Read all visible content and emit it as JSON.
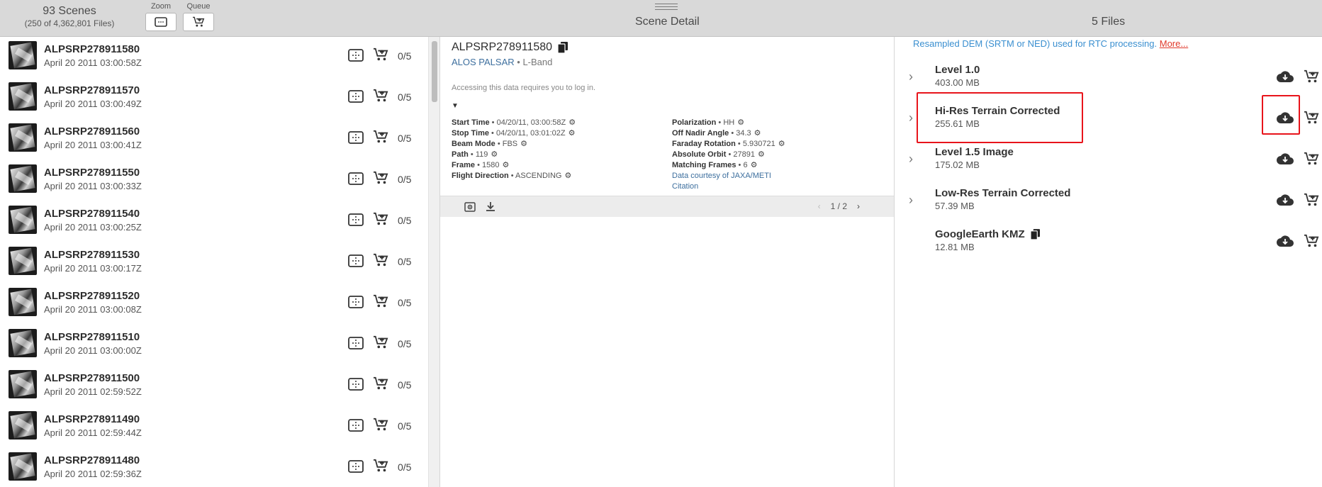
{
  "toolbar": {
    "scene_count": "93 Scenes",
    "files_count": "(250 of 4,362,801 Files)",
    "zoom_label": "Zoom",
    "queue_label": "Queue",
    "detail_title": "Scene Detail",
    "files_title": "5 Files"
  },
  "scenes": [
    {
      "name": "ALPSRP278911580",
      "date": "April 20 2011 03:00:58Z",
      "count": "0/5"
    },
    {
      "name": "ALPSRP278911570",
      "date": "April 20 2011 03:00:49Z",
      "count": "0/5"
    },
    {
      "name": "ALPSRP278911560",
      "date": "April 20 2011 03:00:41Z",
      "count": "0/5"
    },
    {
      "name": "ALPSRP278911550",
      "date": "April 20 2011 03:00:33Z",
      "count": "0/5"
    },
    {
      "name": "ALPSRP278911540",
      "date": "April 20 2011 03:00:25Z",
      "count": "0/5"
    },
    {
      "name": "ALPSRP278911530",
      "date": "April 20 2011 03:00:17Z",
      "count": "0/5"
    },
    {
      "name": "ALPSRP278911520",
      "date": "April 20 2011 03:00:08Z",
      "count": "0/5"
    },
    {
      "name": "ALPSRP278911510",
      "date": "April 20 2011 03:00:00Z",
      "count": "0/5"
    },
    {
      "name": "ALPSRP278911500",
      "date": "April 20 2011 02:59:52Z",
      "count": "0/5"
    },
    {
      "name": "ALPSRP278911490",
      "date": "April 20 2011 02:59:44Z",
      "count": "0/5"
    },
    {
      "name": "ALPSRP278911480",
      "date": "April 20 2011 02:59:36Z",
      "count": "0/5"
    }
  ],
  "detail": {
    "scene_name": "ALPSRP278911580",
    "dataset": "ALOS PALSAR",
    "separator": "•",
    "band": "L-Band",
    "login_note": "Accessing this data requires you to log in.",
    "caret": "▼",
    "left_meta": [
      {
        "key": "Start Time",
        "value": "04/20/11, 03:00:58Z"
      },
      {
        "key": "Stop Time",
        "value": "04/20/11, 03:01:02Z"
      },
      {
        "key": "Beam Mode",
        "value": "FBS"
      },
      {
        "key": "Path",
        "value": "119"
      },
      {
        "key": "Frame",
        "value": "1580"
      },
      {
        "key": "Flight Direction",
        "value": "ASCENDING"
      }
    ],
    "right_meta": [
      {
        "key": "Polarization",
        "value": "HH"
      },
      {
        "key": "Off Nadir Angle",
        "value": "34.3"
      },
      {
        "key": "Faraday Rotation",
        "value": "5.930721"
      },
      {
        "key": "Absolute Orbit",
        "value": "27891"
      },
      {
        "key": "Matching Frames",
        "value": "6"
      }
    ],
    "courtesy_link": "Data courtesy of JAXA/METI",
    "citation_link": "Citation",
    "pager": "1 / 2"
  },
  "files": {
    "banner_text": "Resampled DEM (SRTM or NED) used for RTC processing.",
    "banner_link": "More...",
    "items": [
      {
        "name": "Level 1.0",
        "size": "403.00 MB",
        "expandable": true
      },
      {
        "name": "Hi-Res Terrain Corrected",
        "size": "255.61 MB",
        "expandable": true
      },
      {
        "name": "Level 1.5 Image",
        "size": "175.02 MB",
        "expandable": true
      },
      {
        "name": "Low-Res Terrain Corrected",
        "size": "57.39 MB",
        "expandable": true
      },
      {
        "name": "GoogleEarth KMZ",
        "size": "12.81 MB",
        "expandable": false
      }
    ]
  },
  "colors": {
    "link": "#3d6f9e",
    "banner": "#3a8fd0",
    "highlight": "#e8141b",
    "toolbar": "#d9d9d9"
  },
  "icons": {
    "zoom": "zoom-to-frame-icon",
    "queue": "add-to-cart-icon",
    "download": "cloud-download-icon",
    "copy": "copy-icon",
    "settings": "gear-icon",
    "expand": "chevron-right-icon"
  }
}
